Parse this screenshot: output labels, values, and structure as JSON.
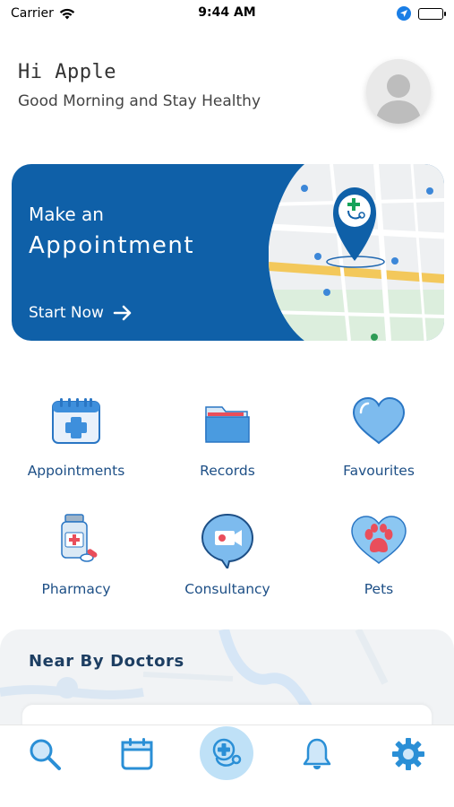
{
  "status_bar": {
    "carrier": "Carrier",
    "time": "9:44 AM"
  },
  "header": {
    "greeting": "Hi Apple",
    "subtitle": "Good Morning and Stay Healthy",
    "avatar_icon": "user-avatar-icon"
  },
  "banner": {
    "line1": "Make an",
    "line2": "Appointment",
    "cta": "Start Now",
    "map_icon": "map-pin-icon"
  },
  "services": [
    {
      "label": "Appointments",
      "icon": "calendar-plus-icon"
    },
    {
      "label": "Records",
      "icon": "folder-icon"
    },
    {
      "label": "Favourites",
      "icon": "heart-icon"
    },
    {
      "label": "Pharmacy",
      "icon": "medicine-bottle-icon"
    },
    {
      "label": "Consultancy",
      "icon": "video-chat-icon"
    },
    {
      "label": "Pets",
      "icon": "paw-heart-icon"
    }
  ],
  "nearby": {
    "title": "Near By Doctors"
  },
  "tabbar": {
    "items": [
      "search-icon",
      "calendar-icon",
      "stethoscope-icon",
      "bell-icon",
      "gear-icon"
    ]
  },
  "colors": {
    "brand_blue": "#0f60a8",
    "label_blue": "#1d4f86",
    "tab_blue": "#2a8fd6",
    "tab_center_bg": "#bfe1f7"
  }
}
